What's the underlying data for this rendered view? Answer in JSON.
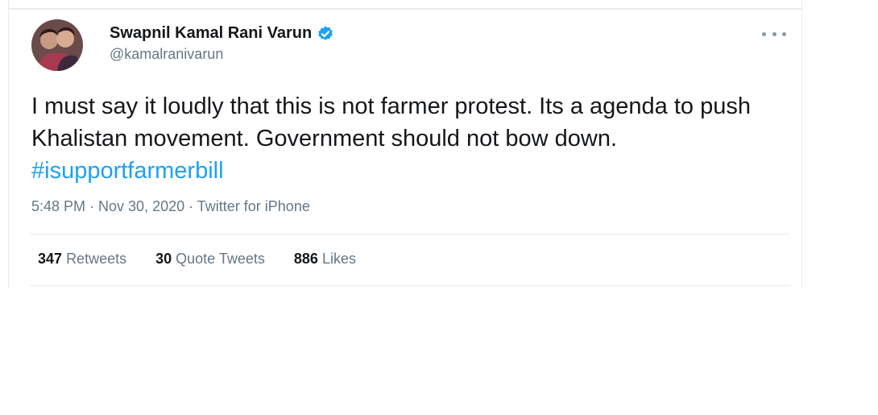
{
  "tweet": {
    "display_name": "Swapnil Kamal Rani Varun",
    "verified": true,
    "handle": "@kamalranivarun",
    "text_before": "I must say it loudly that this is not farmer protest. Its a agenda to push Khalistan movement. Government should not bow down. ",
    "hashtag": "#isupportfarmerbill",
    "meta": "5:48 PM · Nov 30, 2020 · Twitter for iPhone",
    "stats": {
      "retweets_count": "347",
      "retweets_label": "Retweets",
      "quotes_count": "30",
      "quotes_label": "Quote Tweets",
      "likes_count": "886",
      "likes_label": "Likes"
    }
  },
  "colors": {
    "accent": "#1da1f2",
    "text": "#14171a",
    "muted": "#657786",
    "divider": "#e6ecf0"
  },
  "icons": {
    "verified": "verified-badge-icon",
    "more": "more-options-icon"
  }
}
